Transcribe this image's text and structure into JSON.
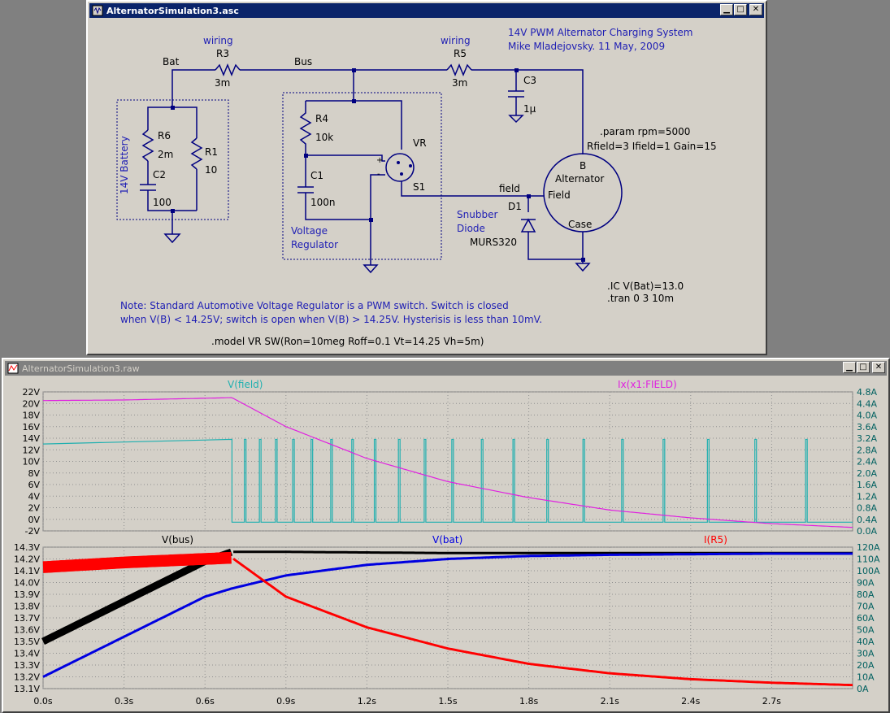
{
  "schematic_window": {
    "title": "AlternatorSimulation3.asc",
    "header_line1": "14V PWM Alternator Charging System",
    "header_line2": "Mike Mladejovsky. 11 May, 2009",
    "wiring1": "wiring",
    "wiring2": "wiring",
    "net_bat": "Bat",
    "net_bus": "Bus",
    "r3_name": "R3",
    "r3_val": "3m",
    "r5_name": "R5",
    "r5_val": "3m",
    "c3_name": "C3",
    "c3_val": "1µ",
    "r6_name": "R6",
    "r6_val": "2m",
    "c2_name": "C2",
    "c2_val": "100",
    "r1_name": "R1",
    "r1_val": "10",
    "battery_label": "14V Battery",
    "r4_name": "R4",
    "r4_val": "10k",
    "c1_name": "C1",
    "c1_val": "100n",
    "vr_name": "VR",
    "s1_name": "S1",
    "vreg_label1": "Voltage",
    "vreg_label2": "Regulator",
    "param_line": ".param rpm=5000",
    "param_line2": "Rfield=3 Ifield=1 Gain=15",
    "alt_b": "B",
    "alt_name": "Alternator",
    "alt_field": "Field",
    "alt_case": "Case",
    "net_field": "field",
    "d1_name": "D1",
    "snubber1": "Snubber",
    "snubber2": "Diode",
    "d1_model": "MURS320",
    "ic_line": ".IC V(Bat)=13.0",
    "tran_line": ".tran 0 3 10m",
    "note_line1": "Note: Standard Automotive Voltage Regulator is a PWM switch. Switch is closed",
    "note_line2": "when V(B) < 14.25V; switch is open when V(B) > 14.25V. Hysterisis is less than 10mV.",
    "model_line": ".model VR SW(Ron=10meg Roff=0.1 Vt=14.25 Vh=5m)",
    "colors": {
      "bg": "#d4d0c8",
      "wire": "#000080",
      "text": "#000000",
      "comment": "#1e1eb4",
      "dashed": "#000080"
    }
  },
  "waveform_window": {
    "title": "AlternatorSimulation3.raw",
    "colors": {
      "bg": "#d4d0c8",
      "plot_bg": "#d4d0c8",
      "grid": "#808080",
      "axis_text": "#000000",
      "right_axis_text": "#008080"
    },
    "x_tick_labels": [
      "0.0s",
      "0.3s",
      "0.6s",
      "0.9s",
      "1.2s",
      "1.5s",
      "1.8s",
      "2.1s",
      "2.4s",
      "2.7s"
    ],
    "chart_data": [
      {
        "type": "line",
        "pane": "top",
        "x_range": [
          0,
          3
        ],
        "left_axis": {
          "ylim": [
            -2,
            22
          ],
          "tick_labels": [
            "22V",
            "20V",
            "18V",
            "16V",
            "14V",
            "12V",
            "10V",
            "8V",
            "6V",
            "4V",
            "2V",
            "0V",
            "-2V"
          ]
        },
        "right_axis": {
          "ylim": [
            0,
            4.8
          ],
          "tick_labels": [
            "4.8A",
            "4.4A",
            "4.0A",
            "3.6A",
            "3.2A",
            "2.8A",
            "2.4A",
            "2.0A",
            "1.6A",
            "1.2A",
            "0.8A",
            "0.4A",
            "0.0A"
          ]
        },
        "series": [
          {
            "name": "V(field)",
            "axis": "left",
            "color": "#20b0b0",
            "kind": "pwm",
            "baseline": 13.0,
            "switch_start": 0.7,
            "high": 13.8,
            "low": -0.5
          },
          {
            "name": "Ix(x1:FIELD)",
            "axis": "right",
            "color": "#e020e0",
            "x": [
              0,
              0.3,
              0.6,
              0.7,
              0.9,
              1.2,
              1.5,
              1.8,
              2.1,
              2.4,
              2.7,
              3.0
            ],
            "y": [
              4.5,
              4.52,
              4.58,
              4.6,
              3.6,
              2.5,
              1.7,
              1.15,
              0.72,
              0.45,
              0.25,
              0.12
            ]
          }
        ]
      },
      {
        "type": "line",
        "pane": "bottom",
        "x_range": [
          0,
          3
        ],
        "left_axis": {
          "ylim": [
            13.1,
            14.3
          ],
          "tick_labels": [
            "14.3V",
            "14.2V",
            "14.1V",
            "14.0V",
            "13.9V",
            "13.8V",
            "13.7V",
            "13.6V",
            "13.5V",
            "13.4V",
            "13.3V",
            "13.2V",
            "13.1V"
          ]
        },
        "right_axis": {
          "ylim": [
            0,
            120
          ],
          "tick_labels": [
            "120A",
            "110A",
            "100A",
            "90A",
            "80A",
            "70A",
            "60A",
            "50A",
            "40A",
            "30A",
            "20A",
            "10A",
            "0A"
          ]
        },
        "series": [
          {
            "name": "V(bus)",
            "axis": "left",
            "color": "#000000",
            "x": [
              0,
              0.3,
              0.6,
              0.7,
              0.9,
              1.2,
              1.5,
              1.8,
              2.1,
              2.4,
              2.7,
              3.0
            ],
            "y": [
              13.5,
              13.84,
              14.18,
              14.26,
              14.26,
              14.255,
              14.25,
              14.25,
              14.25,
              14.25,
              14.25,
              14.25
            ],
            "thickness_before": 0.6
          },
          {
            "name": "V(bat)",
            "axis": "left",
            "color": "#0000e0",
            "x": [
              0,
              0.3,
              0.6,
              0.7,
              0.9,
              1.2,
              1.5,
              1.8,
              2.1,
              2.4,
              2.7,
              3.0
            ],
            "y": [
              13.2,
              13.54,
              13.88,
              13.95,
              14.06,
              14.15,
              14.2,
              14.225,
              14.235,
              14.24,
              14.245,
              14.245
            ]
          },
          {
            "name": "I(R5)",
            "axis": "right",
            "color": "#ff0000",
            "x": [
              0,
              0.3,
              0.6,
              0.7,
              0.9,
              1.2,
              1.5,
              1.8,
              2.1,
              2.4,
              2.7,
              3.0
            ],
            "y": [
              103,
              107,
              110,
              111,
              78,
              52,
              34,
              21,
              13,
              8,
              5,
              3
            ],
            "band_before": 10,
            "band_after": 2
          }
        ]
      }
    ]
  }
}
